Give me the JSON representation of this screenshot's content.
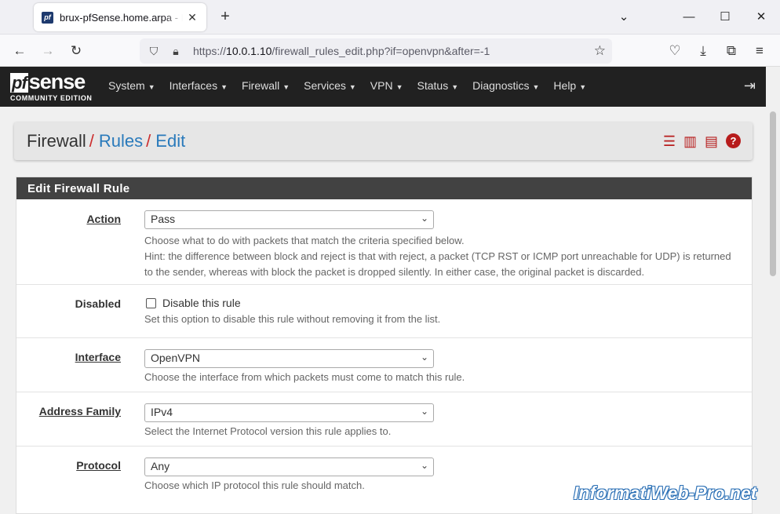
{
  "browser": {
    "tab_title": "brux-pfSense.home.arpa - Firewall",
    "url_prefix": "https://",
    "url_host": "10.0.1.10",
    "url_path": "/firewall_rules_edit.php?if=openvpn&after=-1"
  },
  "pfsense": {
    "logo_main": "sense",
    "logo_pf": "pf",
    "logo_sub": "COMMUNITY EDITION",
    "menu": [
      "System",
      "Interfaces",
      "Firewall",
      "Services",
      "VPN",
      "Status",
      "Diagnostics",
      "Help"
    ]
  },
  "breadcrumb": {
    "root": "Firewall",
    "rules": "Rules",
    "edit": "Edit"
  },
  "panel": {
    "title": "Edit Firewall Rule",
    "action": {
      "label": "Action",
      "value": "Pass",
      "help1": "Choose what to do with packets that match the criteria specified below.",
      "help2": "Hint: the difference between block and reject is that with reject, a packet (TCP RST or ICMP port unreachable for UDP) is returned to the sender, whereas with block the packet is dropped silently. In either case, the original packet is discarded."
    },
    "disabled": {
      "label": "Disabled",
      "checkbox_label": "Disable this rule",
      "help": "Set this option to disable this rule without removing it from the list."
    },
    "interface": {
      "label": "Interface",
      "value": "OpenVPN",
      "help": "Choose the interface from which packets must come to match this rule."
    },
    "address_family": {
      "label": "Address Family",
      "value": "IPv4",
      "help": "Select the Internet Protocol version this rule applies to."
    },
    "protocol": {
      "label": "Protocol",
      "value": "Any",
      "help": "Choose which IP protocol this rule should match."
    }
  },
  "watermark": "InformatiWeb-Pro.net"
}
